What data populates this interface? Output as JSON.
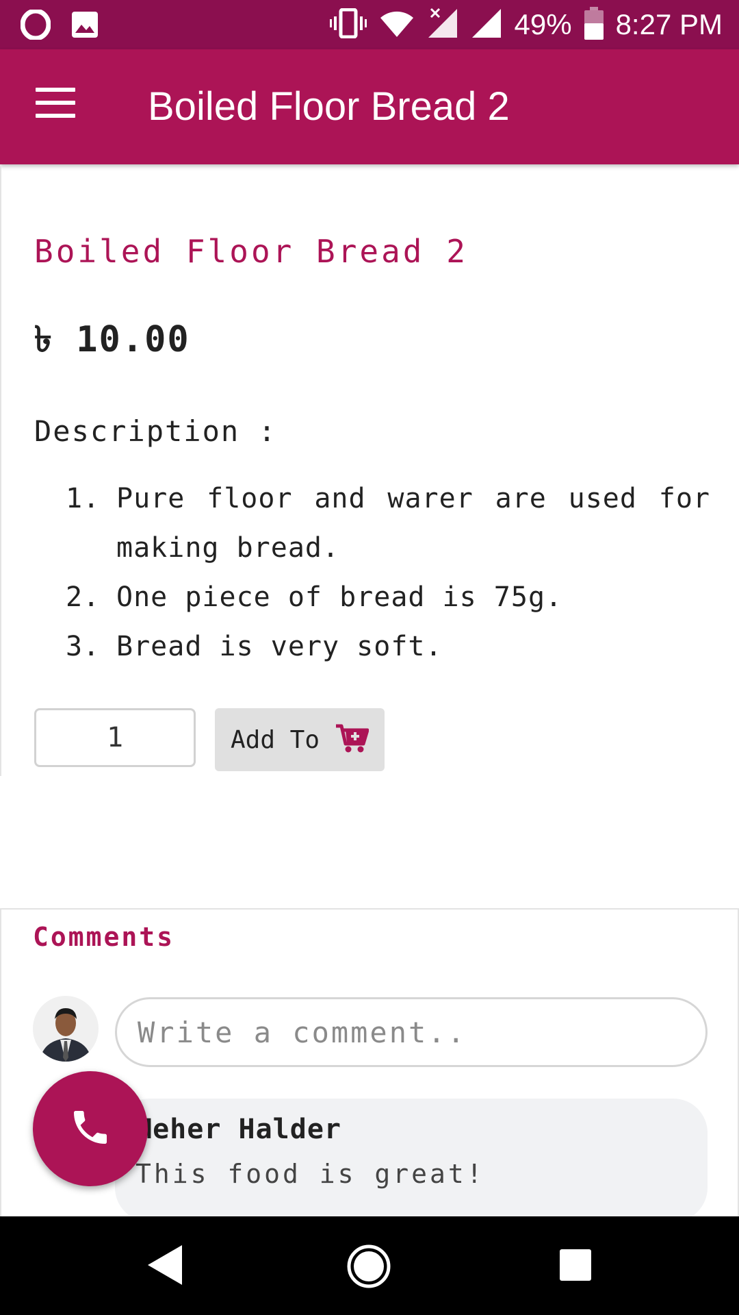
{
  "status_bar": {
    "battery_percent": "49%",
    "time": "8:27 PM",
    "icons": [
      "opera-icon",
      "image-icon",
      "vibrate-icon",
      "wifi-icon",
      "signal-x-icon",
      "signal-icon",
      "battery-icon"
    ]
  },
  "app_bar": {
    "title": "Boiled Floor Bread 2",
    "menu_icon": "hamburger-menu-icon"
  },
  "product": {
    "name": "Boiled Floor Bread 2",
    "price": "৳ 10.00",
    "description_label": "Description :",
    "description_items": [
      {
        "num": "1.",
        "text": "Pure floor and warer are used for making bread."
      },
      {
        "num": "2.",
        "text": "One piece of bread is 75g."
      },
      {
        "num": "3.",
        "text": "Bread is very soft."
      }
    ],
    "quantity": "1",
    "add_button_label": "Add To",
    "add_button_icon": "cart-plus-icon"
  },
  "comments": {
    "title": "Comments",
    "input_placeholder": "Write a comment..",
    "items": [
      {
        "author": "Meher Halder",
        "text": "This food is great!"
      }
    ]
  },
  "fab_icon": "phone-icon",
  "nav_bar": {
    "icons": [
      "back-icon",
      "home-icon",
      "recents-icon"
    ]
  },
  "colors": {
    "status_bar": "#8b0f4f",
    "primary": "#ac1456",
    "button_gray": "#e0e0e0"
  }
}
